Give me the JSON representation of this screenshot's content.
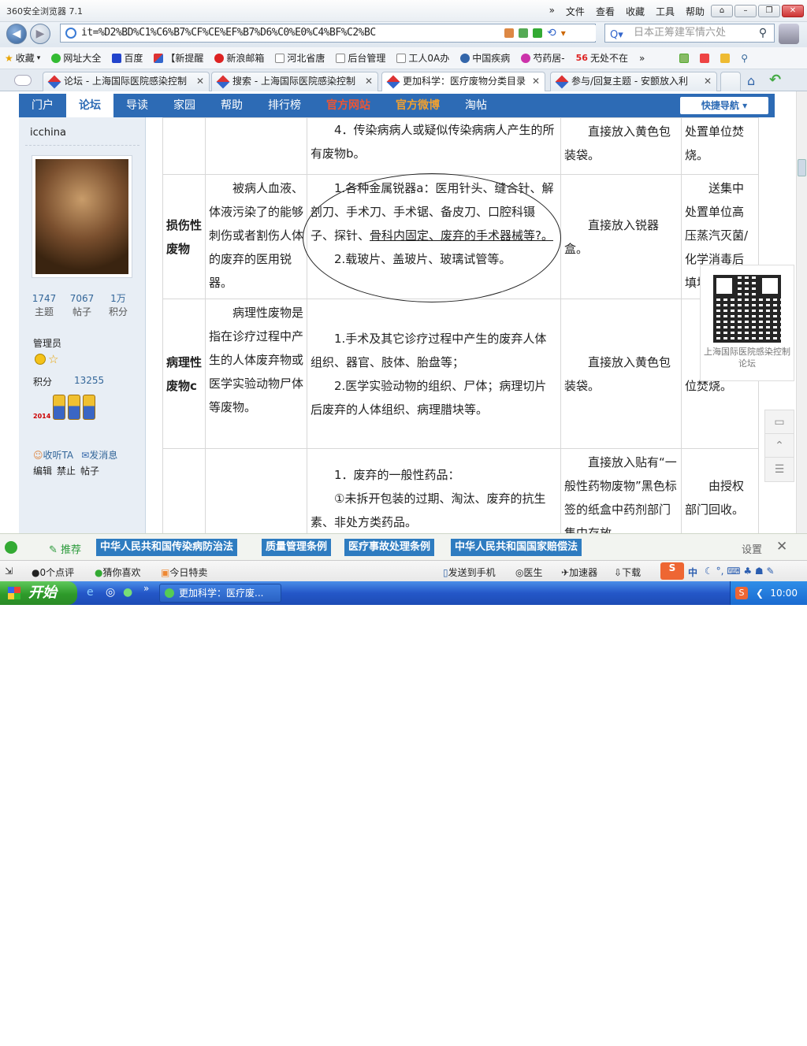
{
  "browser": {
    "title": "360安全浏览器 7.1",
    "menu": [
      "文件",
      "查看",
      "收藏",
      "工具",
      "帮助"
    ],
    "menu_more": "»",
    "address": "it=%D2%BD%C1%C6%B7%CF%CE%EF%B7%D6%C0%E0%C4%BF%C2%BC",
    "search_placeholder": "日本正筹建军情六处"
  },
  "bookmarks": [
    {
      "label": "收藏",
      "icon": "star-icon"
    },
    {
      "label": "网址大全",
      "icon": "plus-icon"
    },
    {
      "label": "百度",
      "icon": "paw-icon"
    },
    {
      "label": "【新提醒",
      "icon": "flag-icon"
    },
    {
      "label": "新浪邮箱",
      "icon": "weibo-icon"
    },
    {
      "label": "河北省唐",
      "icon": "page-icon"
    },
    {
      "label": "后台管理",
      "icon": "page-icon"
    },
    {
      "label": "工人0A办",
      "icon": "page-icon"
    },
    {
      "label": "中国疾病",
      "icon": "globe-icon"
    },
    {
      "label": "芍药居-",
      "icon": "play-icon"
    },
    {
      "label": "无处不在",
      "icon": "logo-56-icon"
    }
  ],
  "bookmark_more": "»",
  "tabs": [
    {
      "label": "论坛 - 上海国际医院感染控制",
      "active": false
    },
    {
      "label": "搜索 - 上海国际医院感染控制",
      "active": false
    },
    {
      "label": "更加科学：医疗废物分类目录",
      "active": true
    },
    {
      "label": "参与/回复主题 - 安颤放入利",
      "active": false
    }
  ],
  "forum_nav": [
    {
      "label": "门户",
      "style": "normal"
    },
    {
      "label": "论坛",
      "style": "active"
    },
    {
      "label": "导读",
      "style": "normal"
    },
    {
      "label": "家园",
      "style": "normal"
    },
    {
      "label": "帮助",
      "style": "normal"
    },
    {
      "label": "排行榜",
      "style": "normal"
    },
    {
      "label": "官方网站",
      "style": "red"
    },
    {
      "label": "官方微博",
      "style": "orange"
    },
    {
      "label": "淘帖",
      "style": "normal"
    }
  ],
  "quick_nav": "快捷导航 ▾",
  "user": {
    "name": "icchina",
    "stats": [
      {
        "value": "1747",
        "label": "主题"
      },
      {
        "value": "7067",
        "label": "帖子"
      },
      {
        "value": "1万",
        "label": "积分"
      }
    ],
    "role": "管理员",
    "score_label": "积分",
    "score_value": "13255",
    "medal_year": "2014",
    "follow": "收听TA",
    "message": "发消息",
    "admin_links": [
      "编辑",
      "禁止",
      "帖子"
    ]
  },
  "table": {
    "rows": [
      {
        "category": "",
        "definition": "",
        "examples": [
          "4．传染病病人或疑似传染病病人产生的所有废物b。"
        ],
        "handling": "直接放入黄色包装袋。",
        "disposal": "处置单位焚烧。"
      },
      {
        "category": "损伤性废物",
        "definition": "被病人血液、体液污染了的能够刺伤或者割伤人体的废弃的医用锐器。",
        "examples_a": "1.各种金属锐器a：医用针头、缝合针、解剖刀、手术刀、手术锯、备皮刀、口腔科镊子、探针、",
        "examples_a_underlined": "骨科内固定、废弃的手术器械等?。",
        "examples_b": "2.载玻片、盖玻片、玻璃试管等。",
        "handling": "直接放入锐器盒。",
        "disposal": "送集中处置单位高压蒸汽灭菌/化学消毒后填埋"
      },
      {
        "category": "病理性废物c",
        "definition": "病理性废物是指在诊疗过程中产生的人体废弃物或医学实验动物尸体等废物。",
        "examples": [
          "1.手术及其它诊疗过程中产生的废弃人体组织、器官、肢体、胎盘等；",
          "2.医学实验动物的组织、尸体；病理切片后废弃的人体组织、病理腊块等。"
        ],
        "handling": "直接放入黄色包装袋。",
        "disposal": "处置单位焚烧。"
      },
      {
        "category": "",
        "definition": "",
        "examples": [
          "1．废弃的一般性药品：",
          "①未拆开包装的过期、淘汰、废弃的抗生素、非处方类药品。"
        ],
        "handling": "直接放入贴有“一般性药物废物”黑色标签的纸盒中药剂部门集中存放",
        "disposal": "由授权部门回收。"
      }
    ]
  },
  "qr_caption": "上海国际医院感染控制论坛",
  "side_tools": [
    "comment-icon",
    "top-icon",
    "list-icon"
  ],
  "recommend": {
    "label": "推荐",
    "tags": [
      "中华人民共和国传染病防治法",
      "质量管理条例",
      "医疗事故处理条例",
      "中华人民共和国国家赔偿法"
    ],
    "settings": "设置",
    "close": "✕"
  },
  "status": {
    "reviews": "0个点评",
    "guess": "猜你喜欢",
    "deals": "今日特卖",
    "send_phone": "发送到手机",
    "doctor": "医生",
    "accelerator": "加速器",
    "download": "下载",
    "ime": "中"
  },
  "taskbar": {
    "start": "开始",
    "task": "更加科学：医疗废...",
    "time": "10:00"
  }
}
